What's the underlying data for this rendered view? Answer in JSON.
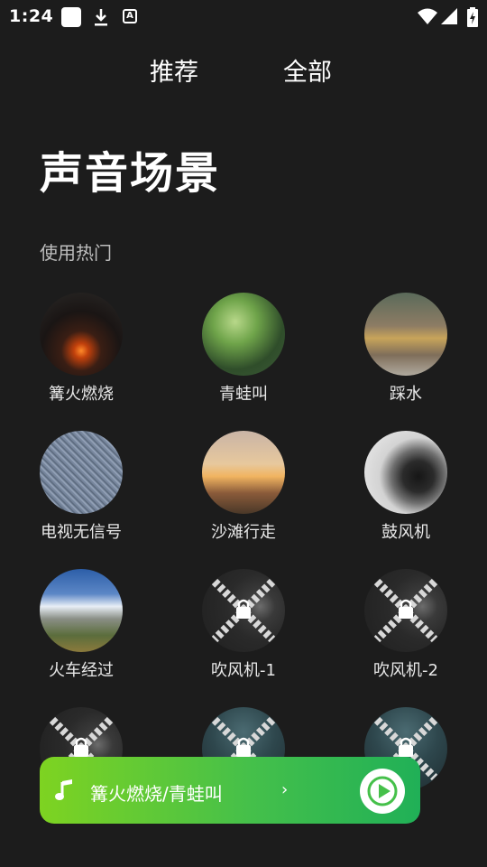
{
  "status_bar": {
    "time": "1:24",
    "icons": [
      "app-square-icon",
      "download-icon",
      "keyboard-a-icon",
      "wifi-icon",
      "signal-icon",
      "battery-charging-icon"
    ],
    "a_glyph": "A"
  },
  "tabs": [
    {
      "label": "推荐"
    },
    {
      "label": "全部"
    }
  ],
  "page_title": "声音场景",
  "section_title": "使用热门",
  "scenes": [
    {
      "label": "篝火燃烧",
      "locked": false
    },
    {
      "label": "青蛙叫",
      "locked": false
    },
    {
      "label": "踩水",
      "locked": false
    },
    {
      "label": "电视无信号",
      "locked": false
    },
    {
      "label": "沙滩行走",
      "locked": false
    },
    {
      "label": "鼓风机",
      "locked": false
    },
    {
      "label": "火车经过",
      "locked": false
    },
    {
      "label": "吹风机-1",
      "locked": true
    },
    {
      "label": "吹风机-2",
      "locked": true
    },
    {
      "label": "",
      "locked": true
    },
    {
      "label": "",
      "locked": true
    },
    {
      "label": "",
      "locked": true
    }
  ],
  "player": {
    "title": "篝火燃烧/青蛙叫",
    "chevron": "›",
    "colors": {
      "start": "#7ed321",
      "end": "#20b057"
    }
  },
  "colors": {
    "background": "#1c1c1c",
    "accent": "#45c04a"
  }
}
